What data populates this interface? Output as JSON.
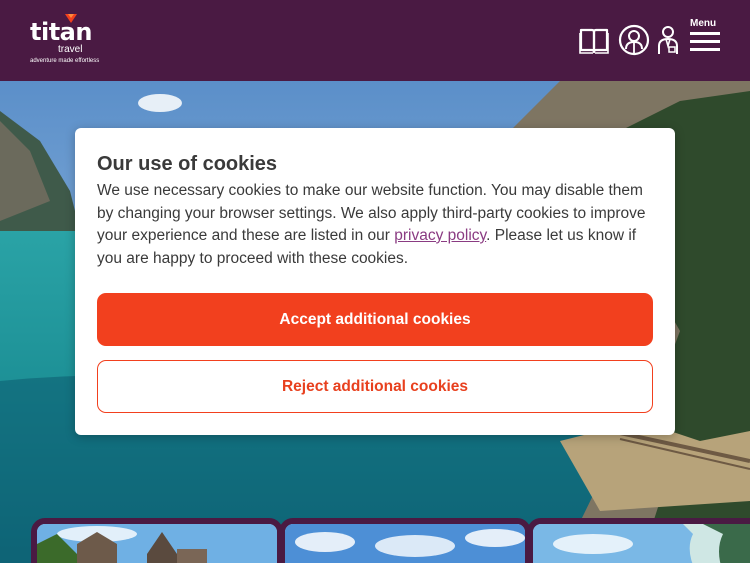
{
  "header": {
    "logo_word": "titan",
    "logo_sub": "travel",
    "logo_tagline": "adventure made effortless",
    "menu_label": "Menu",
    "icons": [
      "book-icon",
      "account-icon",
      "agent-icon",
      "menu-icon"
    ]
  },
  "cookie_dialog": {
    "title": "Our use of cookies",
    "body_before_link": "We use necessary cookies to make our website function. You may disable them by changing your browser settings. We also apply third-party cookies to improve your experience and these are listed in our ",
    "link_text": "privacy policy",
    "body_after_link": ". Please let us know if you are happy to proceed with these cookies.",
    "accept_label": "Accept additional cookies",
    "reject_label": "Reject additional cookies"
  },
  "colors": {
    "header_bg": "#4a1a43",
    "accent": "#f2401e",
    "link": "#8a3b82",
    "text": "#3a3a3a"
  }
}
